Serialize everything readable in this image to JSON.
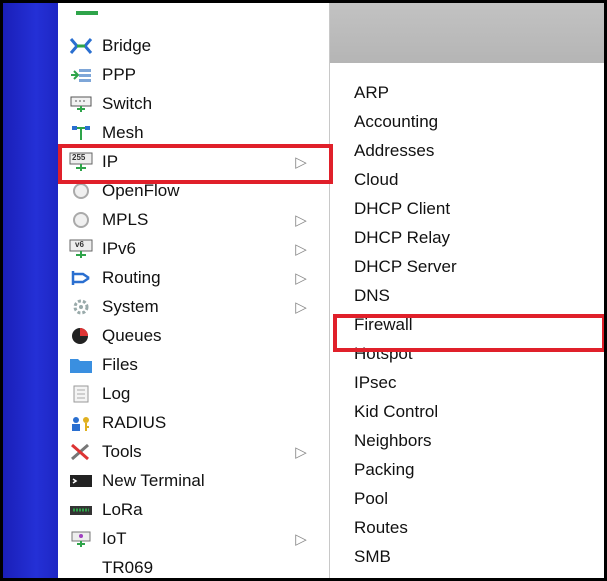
{
  "colors": {
    "leftbar": "#2430d6",
    "highlight": "#e0202a",
    "header": "#b8b8b8"
  },
  "main_menu": {
    "items": [
      {
        "label": "Bridge",
        "icon": "bridge-icon",
        "has_submenu": false
      },
      {
        "label": "PPP",
        "icon": "ppp-icon",
        "has_submenu": false
      },
      {
        "label": "Switch",
        "icon": "switch-icon",
        "has_submenu": false
      },
      {
        "label": "Mesh",
        "icon": "mesh-icon",
        "has_submenu": false
      },
      {
        "label": "IP",
        "icon": "ip-icon",
        "has_submenu": true
      },
      {
        "label": "OpenFlow",
        "icon": "openflow-icon",
        "has_submenu": false
      },
      {
        "label": "MPLS",
        "icon": "mpls-icon",
        "has_submenu": true
      },
      {
        "label": "IPv6",
        "icon": "ipv6-icon",
        "has_submenu": true
      },
      {
        "label": "Routing",
        "icon": "routing-icon",
        "has_submenu": true
      },
      {
        "label": "System",
        "icon": "system-icon",
        "has_submenu": true
      },
      {
        "label": "Queues",
        "icon": "queues-icon",
        "has_submenu": false
      },
      {
        "label": "Files",
        "icon": "files-icon",
        "has_submenu": false
      },
      {
        "label": "Log",
        "icon": "log-icon",
        "has_submenu": false
      },
      {
        "label": "RADIUS",
        "icon": "radius-icon",
        "has_submenu": false
      },
      {
        "label": "Tools",
        "icon": "tools-icon",
        "has_submenu": true
      },
      {
        "label": "New Terminal",
        "icon": "terminal-icon",
        "has_submenu": false
      },
      {
        "label": "LoRa",
        "icon": "lora-icon",
        "has_submenu": false
      },
      {
        "label": "IoT",
        "icon": "iot-icon",
        "has_submenu": true
      },
      {
        "label": "TR069",
        "icon": "",
        "has_submenu": false
      }
    ],
    "arrow_glyph": "▷"
  },
  "ip_icon_text": "255",
  "ipv6_icon_text": "v6",
  "submenu": {
    "items": [
      "ARP",
      "Accounting",
      "Addresses",
      "Cloud",
      "DHCP Client",
      "DHCP Relay",
      "DHCP Server",
      "DNS",
      "Firewall",
      "Hotspot",
      "IPsec",
      "Kid Control",
      "Neighbors",
      "Packing",
      "Pool",
      "Routes",
      "SMB"
    ]
  }
}
